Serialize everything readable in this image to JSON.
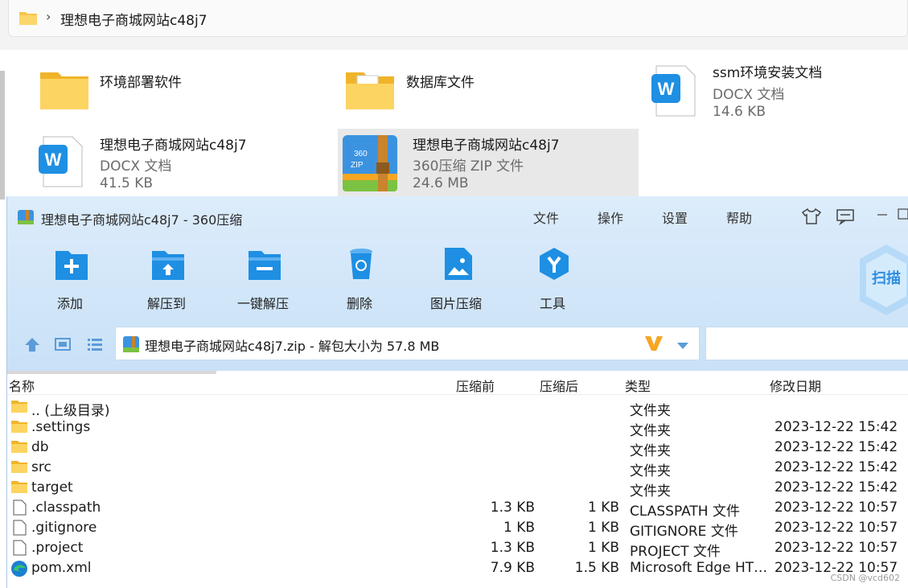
{
  "explorer": {
    "breadcrumb_sep": "›",
    "breadcrumb_path": "理想电子商城网站c48j7",
    "files": [
      {
        "name": "环境部署软件",
        "type": "",
        "size": "",
        "icon": "folder-icon"
      },
      {
        "name": "数据库文件",
        "type": "",
        "size": "",
        "icon": "folder-docs-icon"
      },
      {
        "name": "ssm环境安装文档",
        "type": "DOCX 文档",
        "size": "14.6 KB",
        "icon": "word-doc-icon"
      },
      {
        "name": "理想电子商城网站c48j7",
        "type": "DOCX 文档",
        "size": "41.5 KB",
        "icon": "word-doc-icon"
      },
      {
        "name": "理想电子商城网站c48j7",
        "type": "360压缩 ZIP 文件",
        "size": "24.6 MB",
        "icon": "zip-archive-icon"
      }
    ]
  },
  "app": {
    "title": "理想电子商城网站c48j7 - 360压缩",
    "menu": [
      "文件",
      "操作",
      "设置",
      "帮助"
    ],
    "toolbar": [
      "添加",
      "解压到",
      "一键解压",
      "删除",
      "图片压缩",
      "工具"
    ],
    "scan_label": "扫描",
    "address": "理想电子商城网站c48j7.zip - 解包大小为 57.8 MB",
    "columns": {
      "name": "名称",
      "before": "压缩前",
      "after": "压缩后",
      "type": "类型",
      "date": "修改日期"
    },
    "rows": [
      {
        "name": ".. (上级目录)",
        "before": "",
        "after": "",
        "type": "文件夹",
        "date": "",
        "icon": "folder-icon"
      },
      {
        "name": ".settings",
        "before": "",
        "after": "",
        "type": "文件夹",
        "date": "2023-12-22 15:42",
        "icon": "folder-icon"
      },
      {
        "name": "db",
        "before": "",
        "after": "",
        "type": "文件夹",
        "date": "2023-12-22 15:42",
        "icon": "folder-icon"
      },
      {
        "name": "src",
        "before": "",
        "after": "",
        "type": "文件夹",
        "date": "2023-12-22 15:42",
        "icon": "folder-icon"
      },
      {
        "name": "target",
        "before": "",
        "after": "",
        "type": "文件夹",
        "date": "2023-12-22 15:42",
        "icon": "folder-icon"
      },
      {
        "name": ".classpath",
        "before": "1.3 KB",
        "after": "1 KB",
        "type": "CLASSPATH 文件",
        "date": "2023-12-22 10:57",
        "icon": "file-icon"
      },
      {
        "name": ".gitignore",
        "before": "1 KB",
        "after": "1 KB",
        "type": "GITIGNORE 文件",
        "date": "2023-12-22 10:57",
        "icon": "file-icon"
      },
      {
        "name": ".project",
        "before": "1.3 KB",
        "after": "1 KB",
        "type": "PROJECT 文件",
        "date": "2023-12-22 10:57",
        "icon": "file-icon"
      },
      {
        "name": "pom.xml",
        "before": "7.9 KB",
        "after": "1.5 KB",
        "type": "Microsoft Edge HT…",
        "date": "2023-12-22 10:57",
        "icon": "edge-icon"
      }
    ]
  },
  "watermark": "CSDN @vcd602",
  "colors": {
    "accent": "#1e8fe3",
    "folder": "#f7c548",
    "header_bg": "#d4e7f8"
  }
}
